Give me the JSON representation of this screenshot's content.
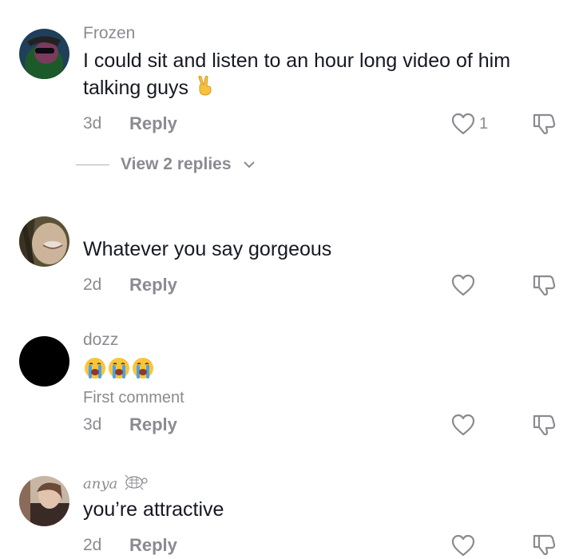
{
  "comments": [
    {
      "username": "Frozen",
      "text": "I could sit and listen to an hour long video of him talking guys",
      "emoji_icons": [
        "victory-hand-icon"
      ],
      "time": "3d",
      "reply_label": "Reply",
      "like_count": "1",
      "view_replies": "View 2 replies"
    },
    {
      "username": "",
      "text": "Whatever you say gorgeous",
      "time": "2d",
      "reply_label": "Reply"
    },
    {
      "username": "dozz",
      "emoji_icons": [
        "loudly-crying-face-icon",
        "loudly-crying-face-icon",
        "loudly-crying-face-icon"
      ],
      "note": "First comment",
      "time": "3d",
      "reply_label": "Reply"
    },
    {
      "username": "anya",
      "username_decoration_icon": "turtle-icon",
      "text": "you’re attractive",
      "time": "2d",
      "reply_label": "Reply"
    }
  ],
  "colors": {
    "text": "#161823",
    "muted": "#8a8b91",
    "background": "#ffffff"
  }
}
